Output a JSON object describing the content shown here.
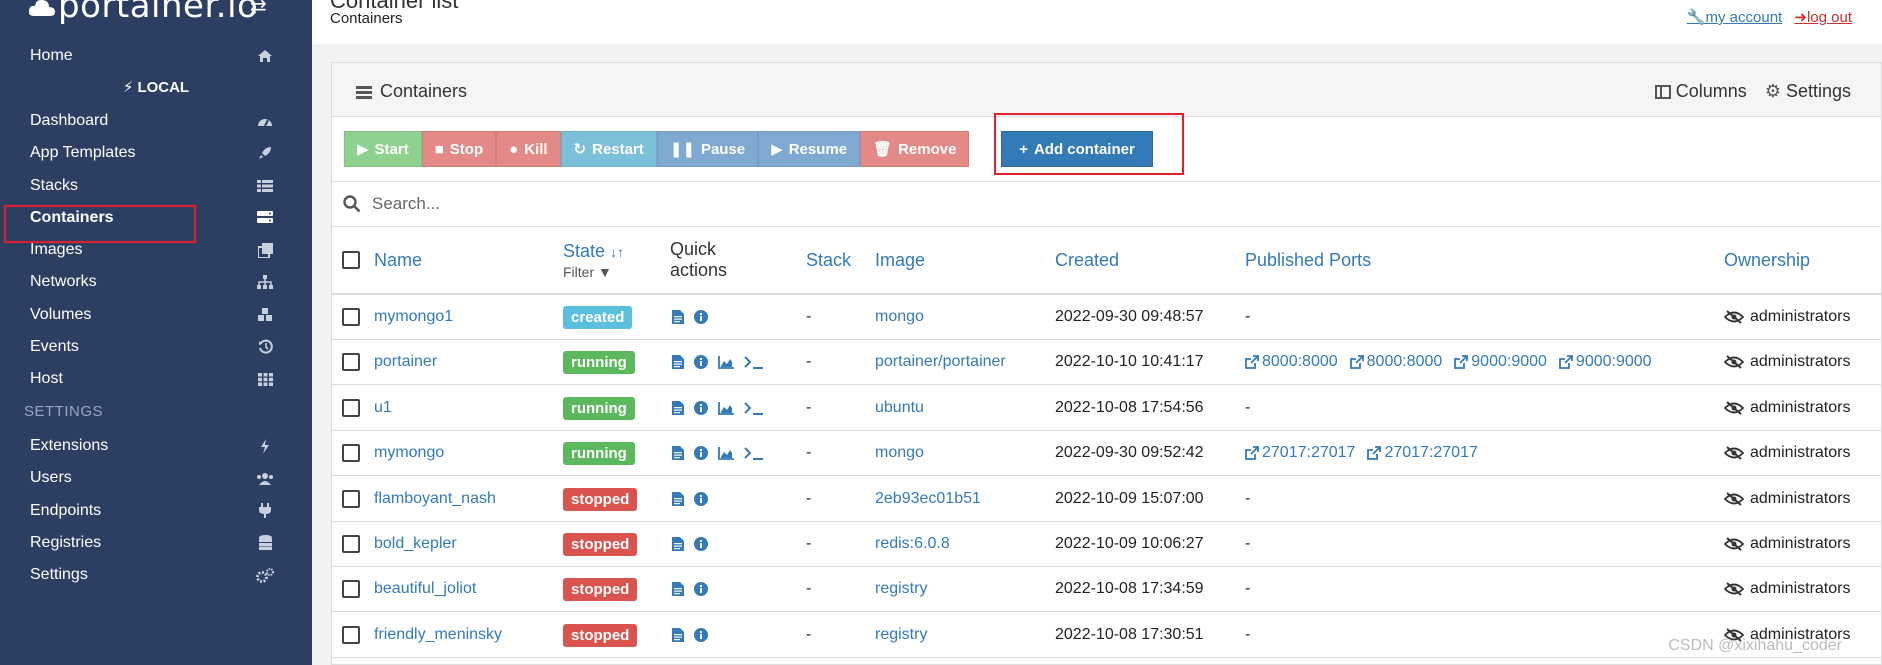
{
  "brand": {
    "logo_text": "portainer.io"
  },
  "sidebar": {
    "home": "Home",
    "endpoint": "LOCAL",
    "items": [
      {
        "label": "Dashboard",
        "icon": "dashboard-icon"
      },
      {
        "label": "App Templates",
        "icon": "rocket-icon"
      },
      {
        "label": "Stacks",
        "icon": "list-icon"
      },
      {
        "label": "Containers",
        "icon": "server-icon"
      },
      {
        "label": "Images",
        "icon": "clone-icon"
      },
      {
        "label": "Networks",
        "icon": "sitemap-icon"
      },
      {
        "label": "Volumes",
        "icon": "cubes-icon"
      },
      {
        "label": "Events",
        "icon": "history-icon"
      },
      {
        "label": "Host",
        "icon": "th-icon"
      }
    ],
    "settings_title": "SETTINGS",
    "settings_items": [
      {
        "label": "Extensions",
        "icon": "bolt-icon"
      },
      {
        "label": "Users",
        "icon": "users-icon"
      },
      {
        "label": "Endpoints",
        "icon": "plug-icon"
      },
      {
        "label": "Registries",
        "icon": "database-icon"
      },
      {
        "label": "Settings",
        "icon": "cogs-icon"
      }
    ]
  },
  "header": {
    "title": "Container list",
    "breadcrumb": "Containers",
    "my_account": "my account",
    "log_out": "log out"
  },
  "panel": {
    "title": "Containers",
    "columns": "Columns",
    "settings": "Settings"
  },
  "actions": {
    "start": "Start",
    "stop": "Stop",
    "kill": "Kill",
    "restart": "Restart",
    "pause": "Pause",
    "resume": "Resume",
    "remove": "Remove",
    "add": "Add container"
  },
  "search": {
    "placeholder": "Search..."
  },
  "table": {
    "headers": {
      "name": "Name",
      "state": "State",
      "state_filter": "Filter",
      "quick_line1": "Quick",
      "quick_line2": "actions",
      "stack": "Stack",
      "image": "Image",
      "created": "Created",
      "ports": "Published Ports",
      "ownership": "Ownership"
    },
    "rows": [
      {
        "name": "mymongo1",
        "state": "created",
        "stack": "-",
        "image": "mongo",
        "created": "2022-09-30 09:48:57",
        "ports": [],
        "ownership": "administrators"
      },
      {
        "name": "portainer",
        "state": "running",
        "stack": "-",
        "image": "portainer/portainer",
        "created": "2022-10-10 10:41:17",
        "ports": [
          "8000:8000",
          "8000:8000",
          "9000:9000",
          "9000:9000"
        ],
        "ownership": "administrators"
      },
      {
        "name": "u1",
        "state": "running",
        "stack": "-",
        "image": "ubuntu",
        "created": "2022-10-08 17:54:56",
        "ports": [],
        "ownership": "administrators"
      },
      {
        "name": "mymongo",
        "state": "running",
        "stack": "-",
        "image": "mongo",
        "created": "2022-09-30 09:52:42",
        "ports": [
          "27017:27017",
          "27017:27017"
        ],
        "ownership": "administrators"
      },
      {
        "name": "flamboyant_nash",
        "state": "stopped",
        "stack": "-",
        "image": "2eb93ec01b51",
        "created": "2022-10-09 15:07:00",
        "ports": [],
        "ownership": "administrators"
      },
      {
        "name": "bold_kepler",
        "state": "stopped",
        "stack": "-",
        "image": "redis:6.0.8",
        "created": "2022-10-09 10:06:27",
        "ports": [],
        "ownership": "administrators"
      },
      {
        "name": "beautiful_joliot",
        "state": "stopped",
        "stack": "-",
        "image": "registry",
        "created": "2022-10-08 17:34:59",
        "ports": [],
        "ownership": "administrators"
      },
      {
        "name": "friendly_meninsky",
        "state": "stopped",
        "stack": "-",
        "image": "registry",
        "created": "2022-10-08 17:30:51",
        "ports": [],
        "ownership": "administrators"
      }
    ],
    "no_ports": "-"
  },
  "watermark": "CSDN @xixihahu_coder",
  "colors": {
    "sidebar": "#2d3e63",
    "link": "#337ab7",
    "created": "#5bc0de",
    "running": "#5cb85c",
    "stopped": "#d9534f",
    "highlight": "#e2202c"
  }
}
